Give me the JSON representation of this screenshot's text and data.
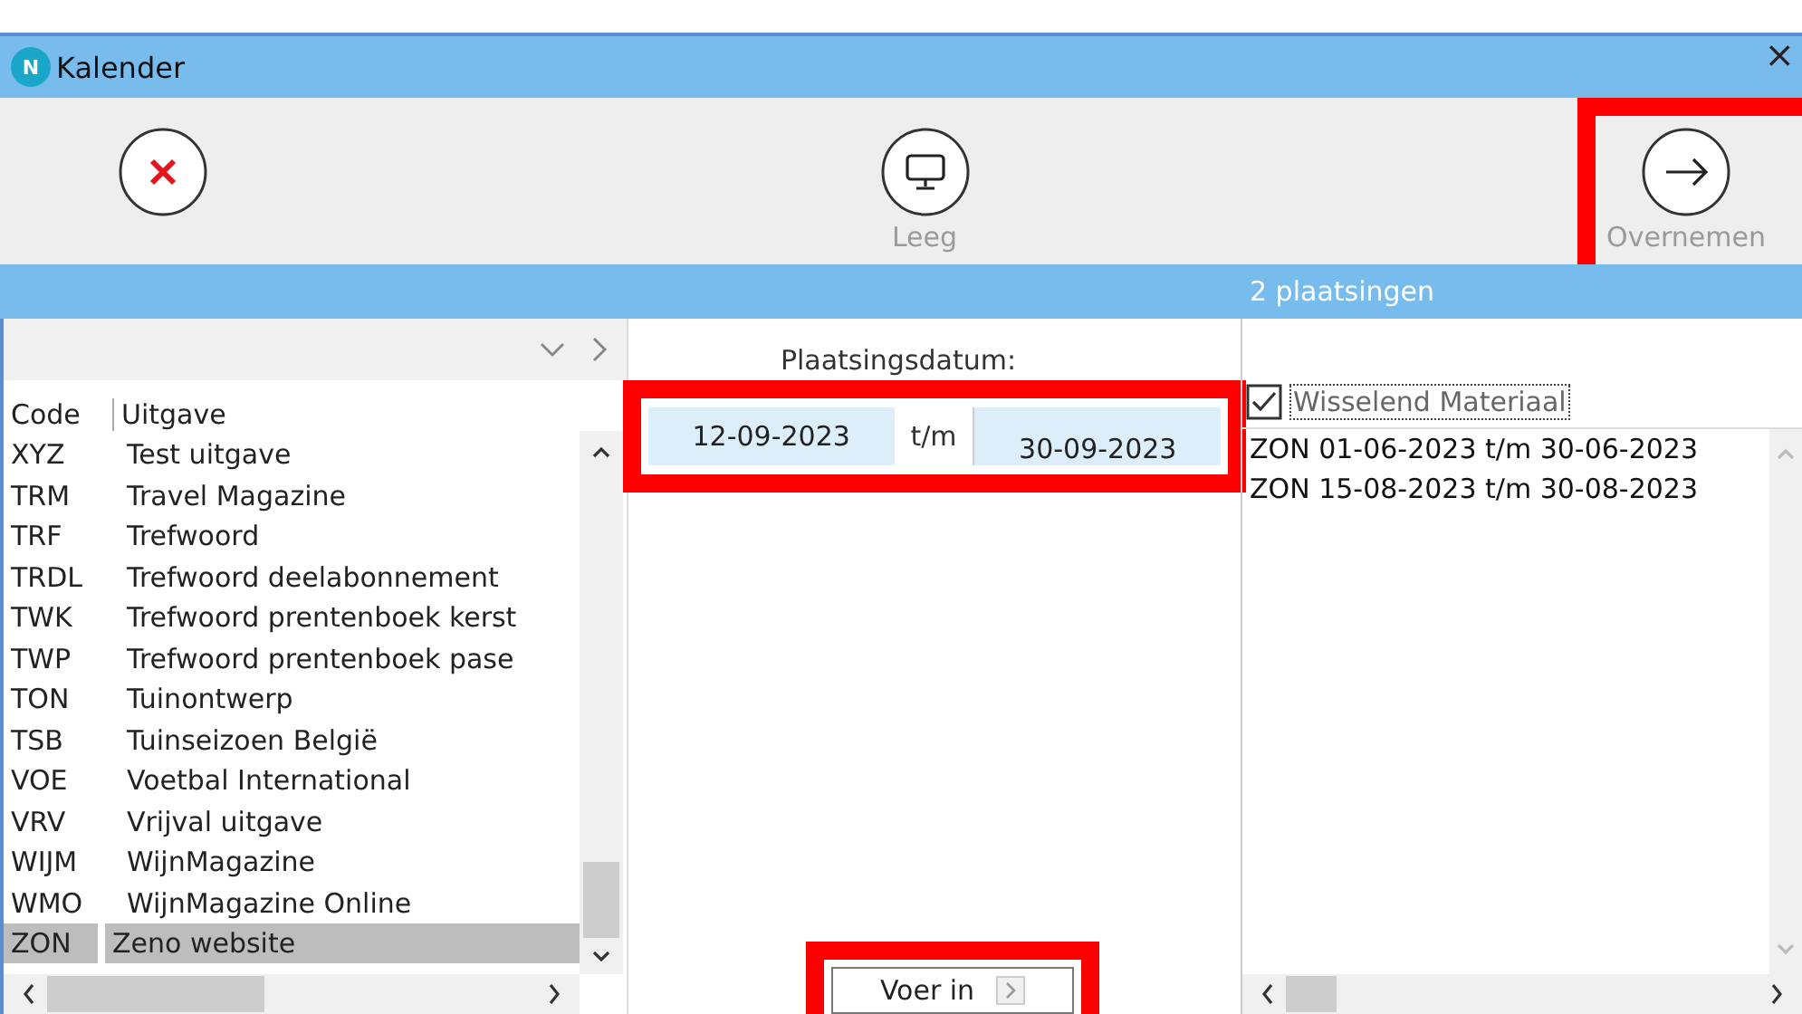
{
  "window": {
    "app_icon": "N",
    "title": "Kalender",
    "close": "×"
  },
  "toolbar": [
    {
      "kind": "cancel",
      "highlighted": false
    },
    {
      "kind": "monitor",
      "label": "Leeg",
      "highlighted": false
    },
    {
      "kind": "arrow",
      "label": "Overnemen",
      "highlighted": true
    }
  ],
  "status_bar": "2 plaatsingen",
  "publications": {
    "columns": [
      "Code",
      "Uitgave"
    ],
    "rows": [
      {
        "code": "XYZ",
        "name": "Test uitgave",
        "selected": false
      },
      {
        "code": "TRM",
        "name": "Travel Magazine",
        "selected": false
      },
      {
        "code": "TRF",
        "name": "Trefwoord",
        "selected": false
      },
      {
        "code": "TRDL",
        "name": "Trefwoord deelabonnement",
        "selected": false
      },
      {
        "code": "TWK",
        "name": "Trefwoord prentenboek kerst",
        "selected": false
      },
      {
        "code": "TWP",
        "name": "Trefwoord prentenboek pase",
        "selected": false
      },
      {
        "code": "TON",
        "name": "Tuinontwerp",
        "selected": false
      },
      {
        "code": "TSB",
        "name": "Tuinseizoen België",
        "selected": false
      },
      {
        "code": "VOE",
        "name": "Voetbal International",
        "selected": false
      },
      {
        "code": "VRV",
        "name": "Vrijval uitgave",
        "selected": false
      },
      {
        "code": "WIJM",
        "name": "WijnMagazine",
        "selected": false
      },
      {
        "code": "WMO",
        "name": "WijnMagazine Online",
        "selected": false
      },
      {
        "code": "ZON",
        "name": "Zeno website",
        "selected": true
      }
    ]
  },
  "date_range": {
    "label": "Plaatsingsdatum:",
    "from": "12-09-2023",
    "separator": "t/m",
    "to": "30-09-2023",
    "highlighted": true
  },
  "submit": {
    "label": "Voer in",
    "highlighted": true
  },
  "material": {
    "label": "Wisselend Materiaal",
    "checked": true,
    "items": [
      "ZON 01-06-2023 t/m 30-06-2023",
      "ZON 15-08-2023 t/m 30-08-2023"
    ]
  }
}
